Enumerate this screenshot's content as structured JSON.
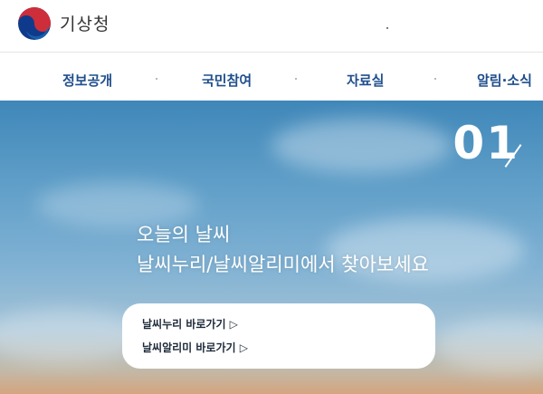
{
  "header": {
    "logo_text": "기상청",
    "logo_icon": "taegeuk-logo-icon"
  },
  "nav": {
    "items": [
      {
        "label": "정보공개"
      },
      {
        "label": "국민참여"
      },
      {
        "label": "자료실"
      },
      {
        "label": "알림·소식"
      }
    ]
  },
  "hero": {
    "slide_number": "01",
    "headline_line1": "오늘의 날씨",
    "headline_line2": "날씨누리/날씨알리미에서 찾아보세요",
    "links": [
      {
        "label": "날씨누리 바로가기 ▷"
      },
      {
        "label": "날씨알리미 바로가기 ▷"
      }
    ]
  },
  "colors": {
    "nav_text": "#1f4e8c",
    "logo_red": "#cd2e3a",
    "logo_blue": "#0f3a8c"
  }
}
